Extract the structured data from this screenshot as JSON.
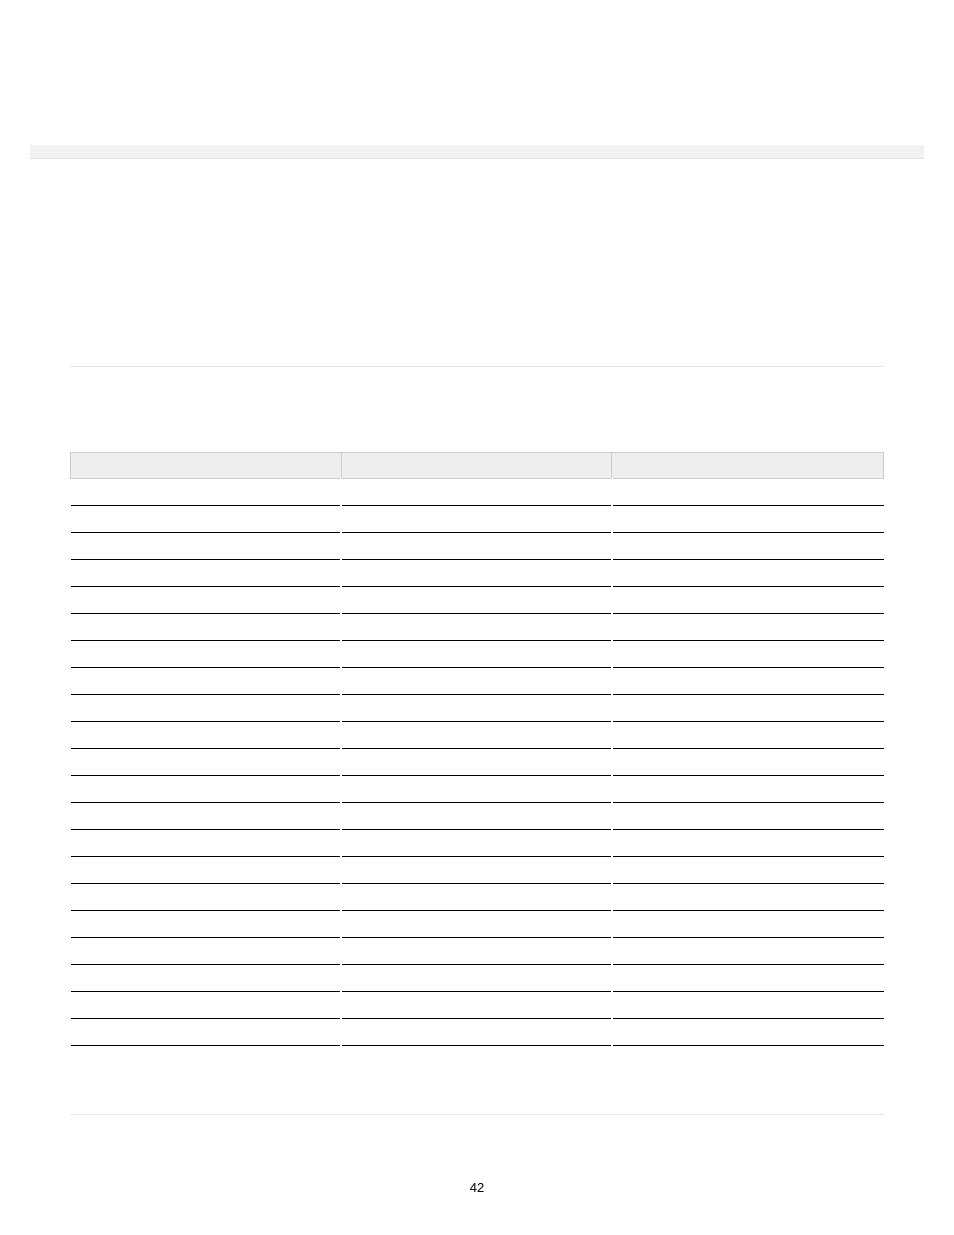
{
  "page_number": "42",
  "table": {
    "columns": [
      "",
      "",
      ""
    ],
    "rows": [
      [
        "",
        "",
        ""
      ],
      [
        "",
        "",
        ""
      ],
      [
        "",
        "",
        ""
      ],
      [
        "",
        "",
        ""
      ],
      [
        "",
        "",
        ""
      ],
      [
        "",
        "",
        ""
      ],
      [
        "",
        "",
        ""
      ],
      [
        "",
        "",
        ""
      ],
      [
        "",
        "",
        ""
      ],
      [
        "",
        "",
        ""
      ],
      [
        "",
        "",
        ""
      ],
      [
        "",
        "",
        ""
      ],
      [
        "",
        "",
        ""
      ],
      [
        "",
        "",
        ""
      ],
      [
        "",
        "",
        ""
      ],
      [
        "",
        "",
        ""
      ],
      [
        "",
        "",
        ""
      ],
      [
        "",
        "",
        ""
      ],
      [
        "",
        "",
        ""
      ],
      [
        "",
        "",
        ""
      ],
      [
        "",
        "",
        ""
      ]
    ]
  }
}
